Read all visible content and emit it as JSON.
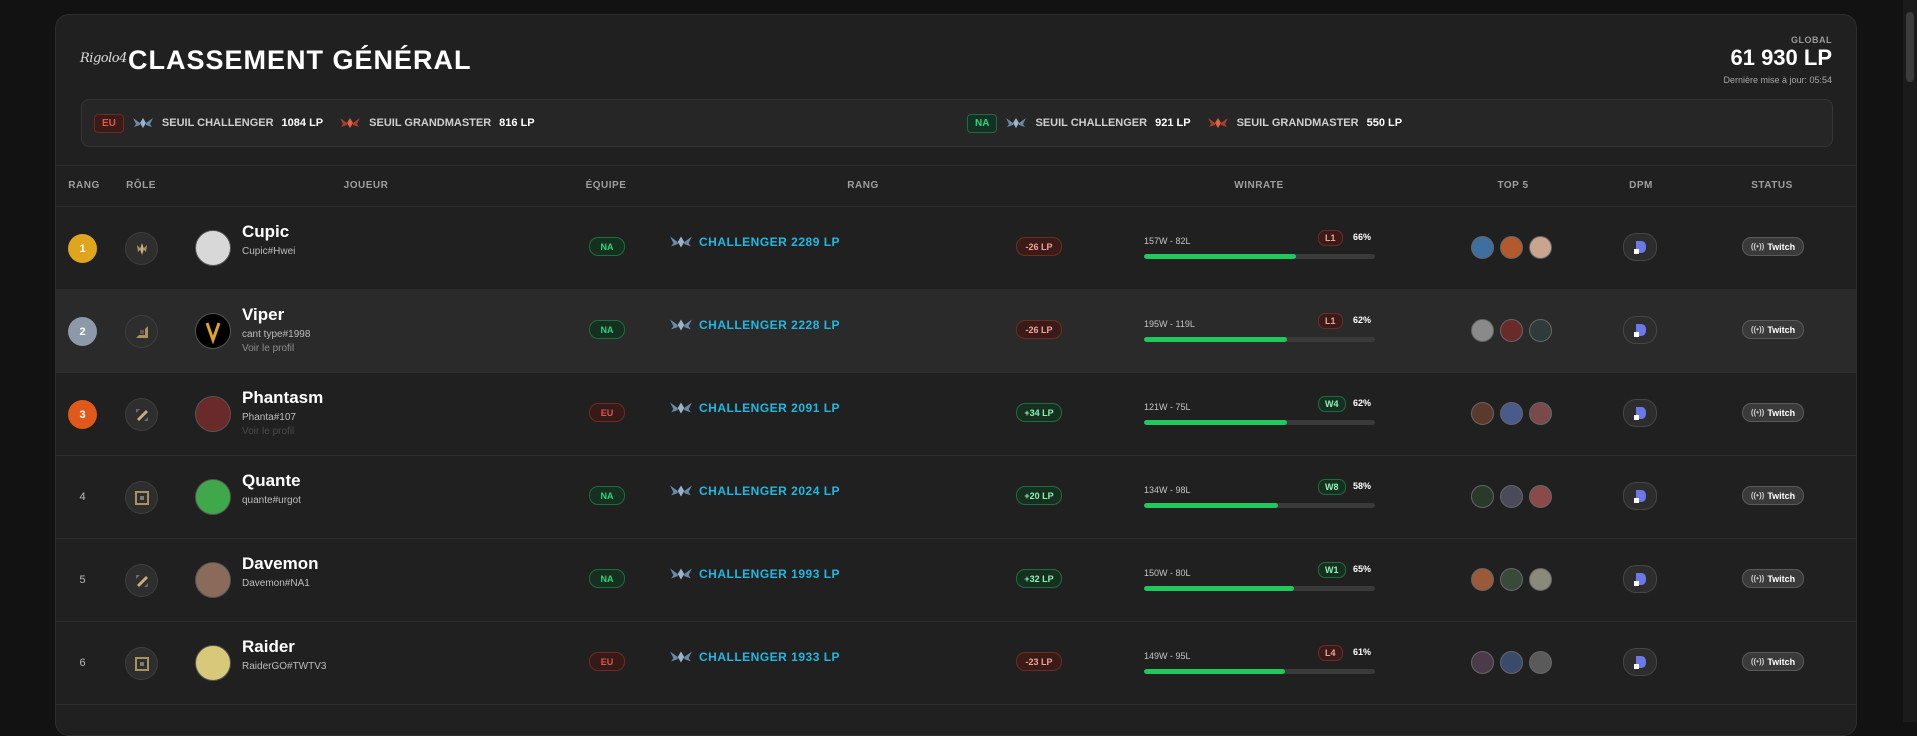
{
  "header": {
    "logo_text": "Rigolo4",
    "title": "CLASSEMENT GÉNÉRAL",
    "global_label": "GLOBAL",
    "global_value": "61 930 LP",
    "update_text": "Dernière mise à jour: 05:54"
  },
  "thresholds": {
    "eu": {
      "region": "EU",
      "challenger_label": "SEUIL CHALLENGER",
      "challenger_value": "1084 LP",
      "grandmaster_label": "SEUIL GRANDMASTER",
      "grandmaster_value": "816 LP"
    },
    "na": {
      "region": "NA",
      "challenger_label": "SEUIL CHALLENGER",
      "challenger_value": "921 LP",
      "grandmaster_label": "SEUIL GRANDMASTER",
      "grandmaster_value": "550 LP"
    }
  },
  "columns": [
    "RANG",
    "RÔLE",
    "JOUEUR",
    "ÉQUIPE",
    "RANG",
    "WINRATE",
    "TOP 5",
    "DPM",
    "STATUS"
  ],
  "colors": {
    "gold": "#e0a51f",
    "silver": "#8d98a8",
    "bronze": "#e0581a",
    "challenger": "#1fb8e0",
    "win": "#1fc95b"
  },
  "rows": [
    {
      "rank": "1",
      "medal": "gold",
      "role_icon": "jungle-icon",
      "name": "Cupic",
      "tag": "Cupic#Hwei",
      "view": "",
      "team": "NA",
      "rank_text": "CHALLENGER 2289 LP",
      "lp_change": "-26 LP",
      "lp_dir": "neg",
      "record": "157W - 82L",
      "streak": "L1",
      "streak_dir": "l",
      "winrate": "66%",
      "winrate_value": 0.66,
      "champs": [
        "#3e6f9e",
        "#b25a2e",
        "#c9a58f"
      ]
    },
    {
      "rank": "2",
      "medal": "silver",
      "role_icon": "bot-icon",
      "name": "Viper",
      "tag": "cant type#1998",
      "view": "Voir le profil",
      "team": "NA",
      "rank_text": "CHALLENGER 2228 LP",
      "lp_change": "-26 LP",
      "lp_dir": "neg",
      "record": "195W - 119L",
      "streak": "L1",
      "streak_dir": "l",
      "winrate": "62%",
      "winrate_value": 0.62,
      "champs": [
        "#8a8a8a",
        "#6a2a2a",
        "#2f3a3a"
      ]
    },
    {
      "rank": "3",
      "medal": "bronze",
      "role_icon": "mid-icon",
      "name": "Phantasm",
      "tag": "Phanta#107",
      "view": "Voir le profil",
      "team": "EU",
      "rank_text": "CHALLENGER 2091 LP",
      "lp_change": "+34 LP",
      "lp_dir": "pos",
      "record": "121W - 75L",
      "streak": "W4",
      "streak_dir": "w",
      "winrate": "62%",
      "winrate_value": 0.62,
      "champs": [
        "#5a3a2a",
        "#4a5a8a",
        "#7a4a4a"
      ]
    },
    {
      "rank": "4",
      "medal": "",
      "role_icon": "support-icon",
      "name": "Quante",
      "tag": "quante#urgot",
      "view": "",
      "team": "NA",
      "rank_text": "CHALLENGER 2024 LP",
      "lp_change": "+20 LP",
      "lp_dir": "pos",
      "record": "134W - 98L",
      "streak": "W8",
      "streak_dir": "w",
      "winrate": "58%",
      "winrate_value": 0.58,
      "champs": [
        "#2a3a2a",
        "#4a4a5a",
        "#8a4a4a"
      ]
    },
    {
      "rank": "5",
      "medal": "",
      "role_icon": "mid-icon",
      "name": "Davemon",
      "tag": "Davemon#NA1",
      "view": "",
      "team": "NA",
      "rank_text": "CHALLENGER 1993 LP",
      "lp_change": "+32 LP",
      "lp_dir": "pos",
      "record": "150W - 80L",
      "streak": "W1",
      "streak_dir": "w",
      "winrate": "65%",
      "winrate_value": 0.65,
      "champs": [
        "#9a5a3a",
        "#3a4a3a",
        "#8a8a7a"
      ]
    },
    {
      "rank": "6",
      "medal": "",
      "role_icon": "support-icon",
      "name": "Raider",
      "tag": "RaiderGO#TWTV3",
      "view": "",
      "team": "EU",
      "rank_text": "CHALLENGER 1933 LP",
      "lp_change": "-23 LP",
      "lp_dir": "neg",
      "record": "149W - 95L",
      "streak": "L4",
      "streak_dir": "l",
      "winrate": "61%",
      "winrate_value": 0.61,
      "champs": [
        "#4a3a4a",
        "#3a4a6a",
        "#5a5a5a"
      ]
    }
  ],
  "twitch_label": "Twitch"
}
